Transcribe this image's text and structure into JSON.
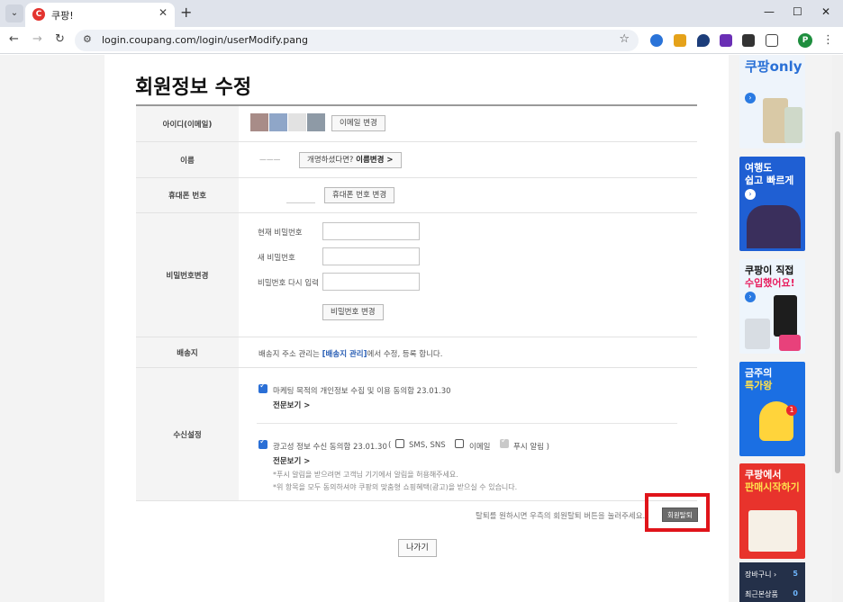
{
  "browser": {
    "tab_title": "쿠팡!",
    "favicon_letter": "C",
    "url": "login.coupang.com/login/userModify.pang",
    "profile_initial": "P"
  },
  "page": {
    "title": "회원정보 수정",
    "rows": {
      "id_label": "아이디(이메일)",
      "id_change_btn": "이메일 변경",
      "name_label": "이름",
      "name_value": "ㅡㅡㅡ",
      "name_change_prefix": "개명하셨다면?",
      "name_change_bold": "이름변경 >",
      "phone_label": "휴대폰 번호",
      "phone_change_btn": "휴대폰 번호 변경",
      "password_label": "비밀번호변경",
      "current_pw": "현재 비밀번호",
      "new_pw": "새 비밀번호",
      "confirm_pw": "비밀번호 다시 입력",
      "pw_change_btn": "비밀번호 변경",
      "shipping_label": "배송지",
      "shipping_pre": "배송지 주소 관리는",
      "shipping_link": "[배송지 관리]",
      "shipping_post": "에서 수정, 등록 합니다.",
      "receive_label": "수신설정",
      "marketing_consent": "마케팅 목적의 개인정보 수집 및 이용 동의함 23.01.30",
      "view_detail": "전문보기 >",
      "ad_consent": "광고성 정보 수신 동의함 23.01.30",
      "sms": "SMS, SNS",
      "email": "이메일",
      "push": "푸시 알림 )",
      "note1": "*푸시 알림을 받으려면 고객님 기기에서 알림을 허용해주세요.",
      "note2": "*위 항목을 모두 동의하셔야 쿠팡의 맞춤형 쇼핑혜택(광고)을 받으실 수 있습니다."
    },
    "withdraw_text": "탈퇴를 원하시면 우측의 회원탈퇴 버튼을 눌러주세요.",
    "withdraw_btn": "회원탈퇴",
    "back_btn": "나가기",
    "id_swatch_colors": [
      "#a88c88",
      "#8fa6c8",
      "#e2e2e2",
      "#8e9aa6"
    ]
  },
  "side": {
    "b1": "쿠팡only",
    "b2_line1": "여행도",
    "b2_line2": "쉽고 빠르게",
    "b3_line1": "쿠팡이 직접",
    "b3_line2": "수입했어요!",
    "b4_line1": "금주의",
    "b4_line2": "특가왕",
    "b5_line1": "쿠팡에서",
    "b5_line2": "판매시작하기",
    "cart_label": "장바구니 ›",
    "cart_count": "5",
    "recent_label": "최근본상품",
    "recent_count": "0"
  }
}
